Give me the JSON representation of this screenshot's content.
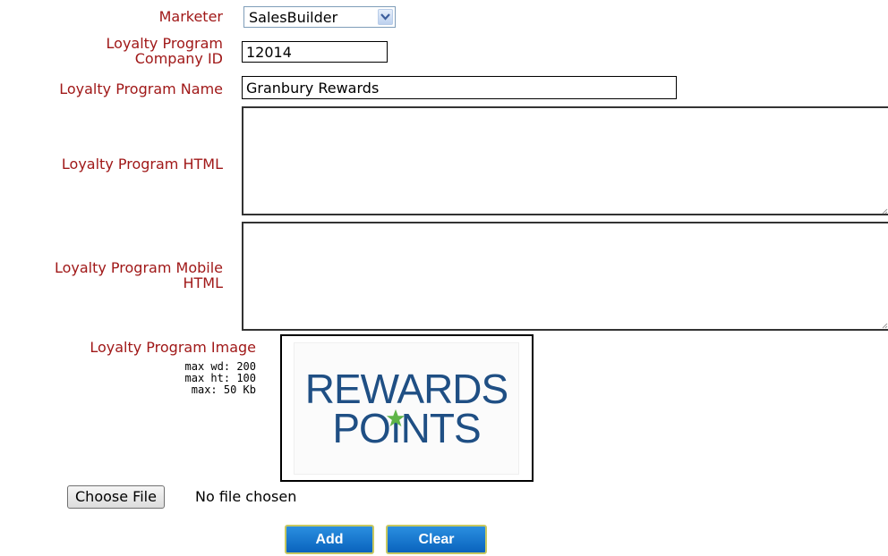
{
  "form": {
    "marketer_label": "Marketer",
    "marketer_value": "SalesBuilder",
    "company_id_label_1": "Loyalty Program",
    "company_id_label_2": "Company ID",
    "company_id_value": "12014",
    "name_label": "Loyalty Program Name",
    "name_value": "Granbury Rewards",
    "html_label": "Loyalty Program HTML",
    "html_value": "",
    "mobile_html_label_1": "Loyalty Program Mobile",
    "mobile_html_label_2": "HTML",
    "mobile_html_value": "",
    "image_label": "Loyalty Program Image",
    "image_hints": [
      "max wd: 200",
      "max ht: 100",
      "max: 50 Kb"
    ],
    "image_logo_line1": "REWARDS",
    "image_logo_line2a": "PO",
    "image_logo_line2b": "NTS"
  },
  "file": {
    "button_label": "Choose File",
    "status": "No file chosen"
  },
  "actions": {
    "add_label": "Add",
    "clear_label": "Clear"
  },
  "colors": {
    "label": "#a01818",
    "button": "#0a63bd",
    "logo_blue": "#1f4f84",
    "logo_star": "#5fb548"
  },
  "icons": {
    "dropdown": "chevron-down-icon",
    "logo_star": "star-icon"
  }
}
